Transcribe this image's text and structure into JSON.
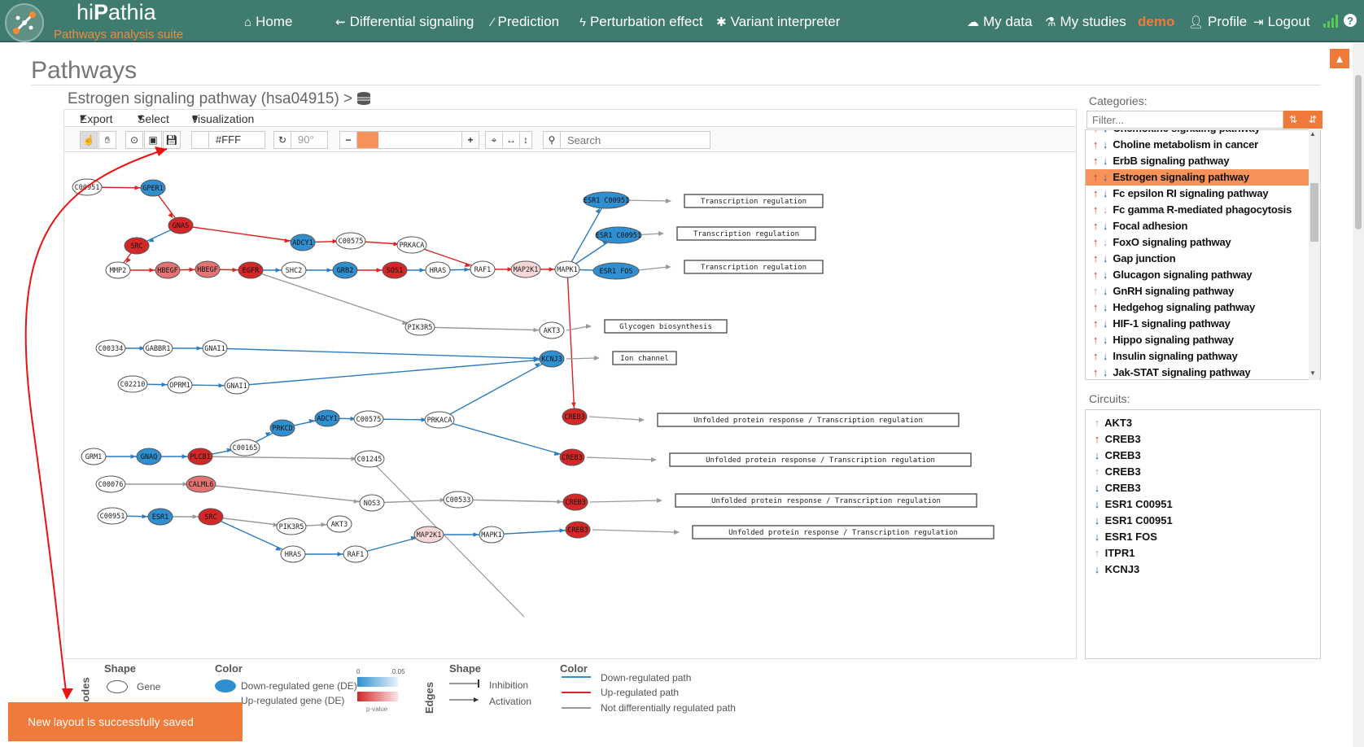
{
  "app": {
    "brand_prefix": "hi",
    "brand_bold": "P",
    "brand_suffix": "athia",
    "subtitle": "Pathways analysis suite"
  },
  "nav": [
    {
      "label": "Home",
      "icon": "home-icon"
    },
    {
      "label": "Differential signaling",
      "icon": "usb-icon"
    },
    {
      "label": "Prediction",
      "icon": "magic-wand-icon"
    },
    {
      "label": "Perturbation effect",
      "icon": "bolt-icon"
    },
    {
      "label": "Variant interpreter",
      "icon": "asterisk-icon"
    }
  ],
  "user_nav": {
    "my_data": "My data",
    "my_studies": "My studies",
    "demo": "demo",
    "profile": "Profile",
    "logout": "Logout"
  },
  "page": {
    "title": "Pathways",
    "pathway_title": "Estrogen signaling pathway (hsa04915)"
  },
  "menu": {
    "export": "Export",
    "select": "Select",
    "visualization": "visualization"
  },
  "toolbar": {
    "color_value": "#FFF",
    "rotation": "90°",
    "search_placeholder": "Search"
  },
  "sidebar": {
    "categories_label": "Categories:",
    "filter_placeholder": "Filter...",
    "circuits_label": "Circuits:",
    "categories": [
      {
        "name": "Chemokine signaling pathway",
        "up": "up",
        "down": "dn"
      },
      {
        "name": "Choline metabolism in cancer",
        "up": "up",
        "down": "dn"
      },
      {
        "name": "ErbB signaling pathway",
        "up": "up",
        "down": "dn"
      },
      {
        "name": "Estrogen signaling pathway",
        "up": "up",
        "down": "dn",
        "selected": true
      },
      {
        "name": "Fc epsilon RI signaling pathway",
        "up": "up",
        "down": "dn"
      },
      {
        "name": "Fc gamma R-mediated phagocytosis",
        "up": "up",
        "down": "gr"
      },
      {
        "name": "Focal adhesion",
        "up": "up",
        "down": "dn"
      },
      {
        "name": "FoxO signaling pathway",
        "up": "up",
        "down": "gr"
      },
      {
        "name": "Gap junction",
        "up": "up",
        "down": "dn"
      },
      {
        "name": "Glucagon signaling pathway",
        "up": "up",
        "down": "dn"
      },
      {
        "name": "GnRH signaling pathway",
        "up": "gr",
        "down": "dn"
      },
      {
        "name": "Hedgehog signaling pathway",
        "up": "up",
        "down": "dn"
      },
      {
        "name": "HIF-1 signaling pathway",
        "up": "up",
        "down": "dn"
      },
      {
        "name": "Hippo signaling pathway",
        "up": "up",
        "down": "dn"
      },
      {
        "name": "Insulin signaling pathway",
        "up": "up",
        "down": "dn"
      },
      {
        "name": "Jak-STAT signaling pathway",
        "up": "up",
        "down": "dn"
      }
    ],
    "circuits": [
      {
        "name": "AKT3",
        "dir": "gr"
      },
      {
        "name": "CREB3",
        "dir": "up"
      },
      {
        "name": "CREB3",
        "dir": "dn"
      },
      {
        "name": "CREB3",
        "dir": "gr"
      },
      {
        "name": "CREB3",
        "dir": "dn"
      },
      {
        "name": "ESR1 C00951",
        "dir": "dn"
      },
      {
        "name": "ESR1 C00951",
        "dir": "dn"
      },
      {
        "name": "ESR1 FOS",
        "dir": "dn"
      },
      {
        "name": "ITPR1",
        "dir": "gr"
      },
      {
        "name": "KCNJ3",
        "dir": "dn"
      }
    ]
  },
  "graph": {
    "nodes": [
      {
        "id": "C00951",
        "t": "w"
      },
      {
        "id": "GPER1",
        "t": "b"
      },
      {
        "id": "GNAS",
        "t": "r"
      },
      {
        "id": "SRC",
        "t": "r"
      },
      {
        "id": "ADCY1",
        "t": "b"
      },
      {
        "id": "C00575",
        "t": "w"
      },
      {
        "id": "PRKACA",
        "t": "w"
      },
      {
        "id": "MMP2",
        "t": "w"
      },
      {
        "id": "HBEGF",
        "t": "lr"
      },
      {
        "id": "HBEGF",
        "t": "lr"
      },
      {
        "id": "EGFR",
        "t": "r"
      },
      {
        "id": "SHC2",
        "t": "w"
      },
      {
        "id": "GRB2",
        "t": "b"
      },
      {
        "id": "SOS1",
        "t": "r"
      },
      {
        "id": "HRAS",
        "t": "w"
      },
      {
        "id": "RAF1",
        "t": "w"
      },
      {
        "id": "MAP2K1",
        "t": "pk"
      },
      {
        "id": "MAPK1",
        "t": "w"
      },
      {
        "id": "ESR1 C00951",
        "t": "b"
      },
      {
        "id": "ESR1 C00951",
        "t": "b"
      },
      {
        "id": "ESR1 FOS",
        "t": "b"
      },
      {
        "id": "PIK3R5",
        "t": "w"
      },
      {
        "id": "AKT3",
        "t": "w"
      },
      {
        "id": "C00334",
        "t": "w"
      },
      {
        "id": "GABBR1",
        "t": "w"
      },
      {
        "id": "GNAI1",
        "t": "w"
      },
      {
        "id": "KCNJ3",
        "t": "b"
      },
      {
        "id": "C02210",
        "t": "w"
      },
      {
        "id": "OPRM1",
        "t": "w"
      },
      {
        "id": "GNAI1",
        "t": "w"
      },
      {
        "id": "CREB3",
        "t": "r"
      },
      {
        "id": "ADCY1",
        "t": "b"
      },
      {
        "id": "C00575",
        "t": "w"
      },
      {
        "id": "PRKACA",
        "t": "w"
      },
      {
        "id": "PRKCD",
        "t": "b"
      },
      {
        "id": "C00165",
        "t": "w"
      },
      {
        "id": "GRM1",
        "t": "w"
      },
      {
        "id": "GNAQ",
        "t": "b"
      },
      {
        "id": "PLCB1",
        "t": "r"
      },
      {
        "id": "C01245",
        "t": "w"
      },
      {
        "id": "CREB3",
        "t": "r"
      },
      {
        "id": "C00076",
        "t": "w"
      },
      {
        "id": "CALML6",
        "t": "lr"
      },
      {
        "id": "NOS3",
        "t": "w"
      },
      {
        "id": "C00533",
        "t": "w"
      },
      {
        "id": "CREB3",
        "t": "r"
      },
      {
        "id": "C00951",
        "t": "w"
      },
      {
        "id": "ESR1",
        "t": "b"
      },
      {
        "id": "SRC",
        "t": "r"
      },
      {
        "id": "PIK3R5",
        "t": "w"
      },
      {
        "id": "AKT3",
        "t": "w"
      },
      {
        "id": "HRAS",
        "t": "w"
      },
      {
        "id": "RAF1",
        "t": "w"
      },
      {
        "id": "MAP2K1",
        "t": "pk"
      },
      {
        "id": "MAPK1",
        "t": "w"
      },
      {
        "id": "CREB3",
        "t": "r"
      }
    ],
    "functions": [
      "Transcription regulation",
      "Transcription regulation",
      "Transcription regulation",
      "Glycogen biosynthesis",
      "Ion channel",
      "Unfolded protein response / Transcription regulation",
      "Unfolded protein response / Transcription regulation",
      "Unfolded protein response / Transcription regulation",
      "Unfolded protein response / Transcription regulation"
    ]
  },
  "legend": {
    "nodes_title": "odes",
    "shape_title": "Shape",
    "color_title": "Color",
    "gene_label": "Gene",
    "down_gene": "Down-regulated gene (DE)",
    "up_gene": "Up-regulated gene (DE)",
    "scale_min": "0",
    "scale_max": "0.05",
    "pvalue": "p-value",
    "edges_title": "Edges",
    "edge_shape_title": "Shape",
    "edge_color_title": "Color",
    "inhibition": "Inhibition",
    "activation": "Activation",
    "down_path": "Down-regulated path",
    "up_path": "Up-regulated path",
    "not_de_path": "Not differentially regulated path"
  },
  "toast": "New layout is successfully saved",
  "colors": {
    "topbar": "#3f7b6e",
    "accent": "#f07a3a",
    "down": "#2f8fd0",
    "up": "#d62728"
  }
}
